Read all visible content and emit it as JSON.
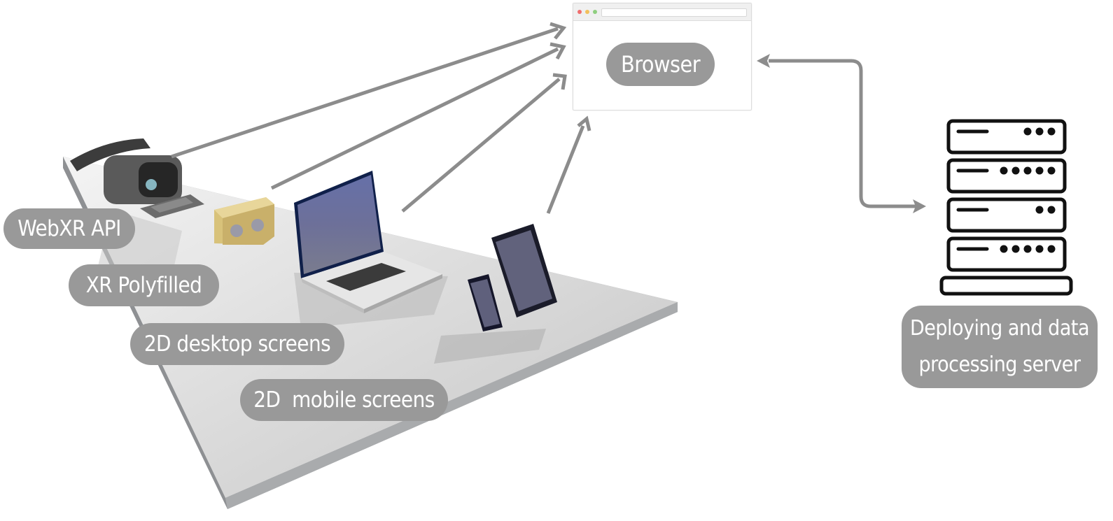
{
  "diagram": {
    "title": "",
    "devices": [
      {
        "id": "webxr",
        "label": "WebXR API",
        "icon": "vr-headset-icon"
      },
      {
        "id": "polyfill",
        "label": "XR Polyfilled",
        "icon": "cardboard-viewer-icon"
      },
      {
        "id": "desktop",
        "label": "2D desktop screens",
        "icon": "laptop-icon"
      },
      {
        "id": "mobile",
        "label": "2D  mobile screens",
        "icon": "tablet-phone-icon"
      }
    ],
    "browser": {
      "label": "Browser",
      "icon": "browser-window-icon"
    },
    "server": {
      "label_line1": "Deploying and data",
      "label_line2": "processing server",
      "icon": "server-rack-icon",
      "units": [
        {
          "leds": 3
        },
        {
          "leds": 5
        },
        {
          "leds": 2
        },
        {
          "leds": 5
        }
      ]
    },
    "edges": [
      {
        "from": "webxr",
        "to": "browser",
        "direction": "one-way"
      },
      {
        "from": "polyfill",
        "to": "browser",
        "direction": "one-way"
      },
      {
        "from": "desktop",
        "to": "browser",
        "direction": "one-way"
      },
      {
        "from": "mobile",
        "to": "browser",
        "direction": "one-way"
      },
      {
        "from": "browser",
        "to": "server",
        "direction": "two-way"
      }
    ],
    "colors": {
      "arrow": "#8c8c8c",
      "pill": "#999999",
      "pill_text": "#ffffff",
      "window_dot_red": "#f06e6e",
      "window_dot_yellow": "#f2c05c",
      "window_dot_green": "#8fcf7f"
    }
  }
}
